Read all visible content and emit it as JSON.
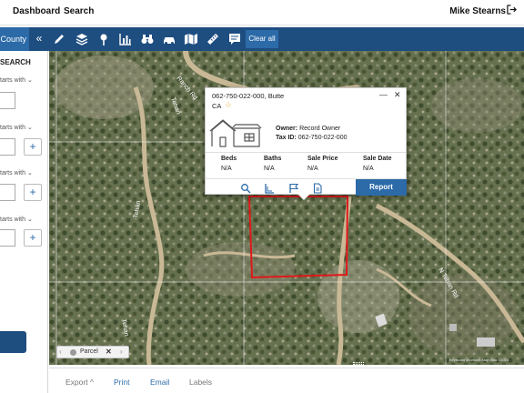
{
  "header": {
    "nav": [
      "Dashboard",
      "Search"
    ],
    "user_name": "Mike Stearns",
    "logout_icon": "logout-icon"
  },
  "toolbar": {
    "county_label": "County",
    "collapse_glyph": "«",
    "tools": [
      "pencil-icon",
      "layers-icon",
      "map-pin-icon",
      "chart-icon",
      "binoculars-icon",
      "car-icon",
      "map-icon",
      "ruler-icon",
      "comment-icon"
    ],
    "clear_all_label": "Clear all",
    "colors": {
      "toolbar_bg": "#1e4d80",
      "accent": "#2c6aa8"
    }
  },
  "sidebar": {
    "title": "SEARCH",
    "filters": [
      {
        "label": "tarts with"
      },
      {
        "label": "tarts with",
        "add": "+"
      },
      {
        "label": "tarts with",
        "add": "+"
      },
      {
        "label": "tarts with",
        "add": "+"
      }
    ]
  },
  "map": {
    "road_labels": [
      "Ranch Rd",
      "Tehan",
      "Tehan",
      "Tehan",
      "N Tehan Rd",
      "Tehan"
    ],
    "parcel_chip": {
      "left_arrow": "‹",
      "label": "Parcel",
      "remove": "✕",
      "right_arrow": "›"
    },
    "attribution": "Keyboard shortcuts    Map data ©2024",
    "parcel_outline_color": "#e0191b"
  },
  "popup": {
    "title": "062-750-022-000, Butte",
    "state": "CA",
    "star": "☆",
    "minimize": "—",
    "close": "✕",
    "owner_label": "Owner:",
    "owner_value": "Record Owner",
    "tax_label": "Tax ID:",
    "tax_value": "062-750-022-000",
    "stats": [
      {
        "label": "Beds",
        "value": "N/A"
      },
      {
        "label": "Baths",
        "value": "N/A"
      },
      {
        "label": "Sale Price",
        "value": "N/A"
      },
      {
        "label": "Sale Date",
        "value": "N/A"
      }
    ],
    "actions": [
      "search-icon",
      "ruler-angle-icon",
      "flag-icon",
      "document-icon"
    ],
    "report_label": "Report"
  },
  "bottom_bar": {
    "export_label": "Export ^",
    "print_label": "Print",
    "email_label": "Email",
    "labels_label": "Labels"
  }
}
